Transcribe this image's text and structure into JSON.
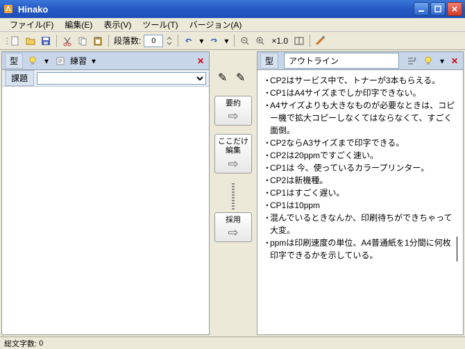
{
  "window": {
    "title": "Hinako"
  },
  "menu": {
    "file": "ファイル(F)",
    "edit": "編集(E)",
    "view": "表示(V)",
    "tool": "ツール(T)",
    "version": "バージョン(A)"
  },
  "toolbar": {
    "paragraph_label": "段落数:",
    "paragraph_value": "0",
    "zoom": "×1.0"
  },
  "left_panel": {
    "type_label": "型",
    "practice_label": "練習",
    "subject_label": "課題"
  },
  "middle": {
    "summary": "要約",
    "edit_here_1": "ここだけ",
    "edit_here_2": "編集",
    "adopt": "採用"
  },
  "right_panel": {
    "type_label": "型",
    "title": "アウトライン"
  },
  "outline_items": [
    "CP2はサービス中で、トナーが3本もらえる。",
    "CP1はA4サイズまでしか印字できない。",
    "A4サイズよりも大きなものが必要なときは、コピー機で拡大コピーしなくてはならなくて、すごく面倒。",
    "CP2ならA3サイズまで印字できる。",
    "CP2は20ppmですごく速い。",
    "CP1は 今、使っているカラープリンター。",
    "CP2は新機種。",
    "CP1はすごく遅い。",
    "CP1は10ppm",
    "混んでいるときなんか、印刷待ちができちゃって大変。",
    "ppmは印刷速度の単位、A4普通紙を1分間に何枚印字できるかを示している。"
  ],
  "status": {
    "char_count_label": "総文字数:",
    "char_count_value": "0"
  }
}
